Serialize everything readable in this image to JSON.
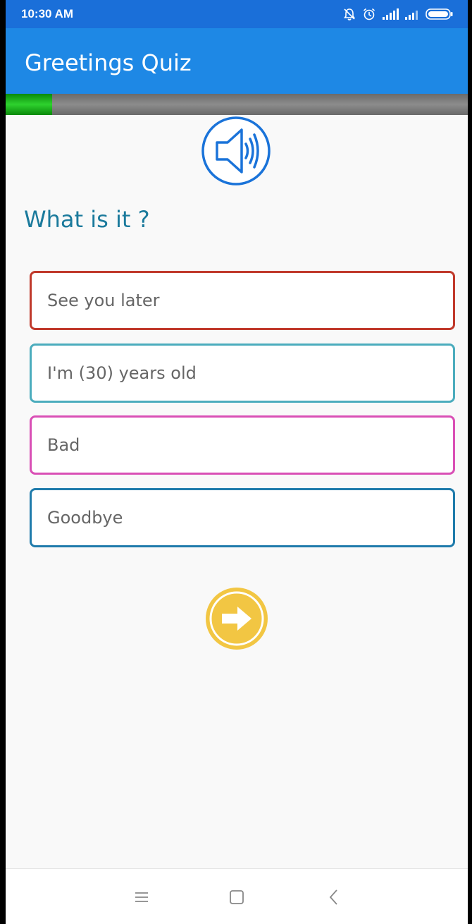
{
  "status_bar": {
    "time": "10:30 AM",
    "icons": [
      "notifications-off-icon",
      "alarm-icon",
      "signal-icon",
      "signal-icon",
      "battery-icon"
    ]
  },
  "app_bar": {
    "title": "Greetings Quiz",
    "color": "#1e88e5"
  },
  "progress": {
    "fraction": 0.1
  },
  "quiz": {
    "audio_icon": "speaker-icon",
    "question": "What is it ?",
    "options": [
      {
        "label": "See you later",
        "border_color": "#c0392b"
      },
      {
        "label": "I'm (30) years old",
        "border_color": "#4bacbd"
      },
      {
        "label": "Bad",
        "border_color": "#d94fb5"
      },
      {
        "label": "Goodbye",
        "border_color": "#1f7bab"
      }
    ],
    "next_icon": "arrow-right-icon"
  },
  "nav_bar": {
    "icons": [
      "menu-icon",
      "home-icon",
      "back-icon"
    ]
  }
}
